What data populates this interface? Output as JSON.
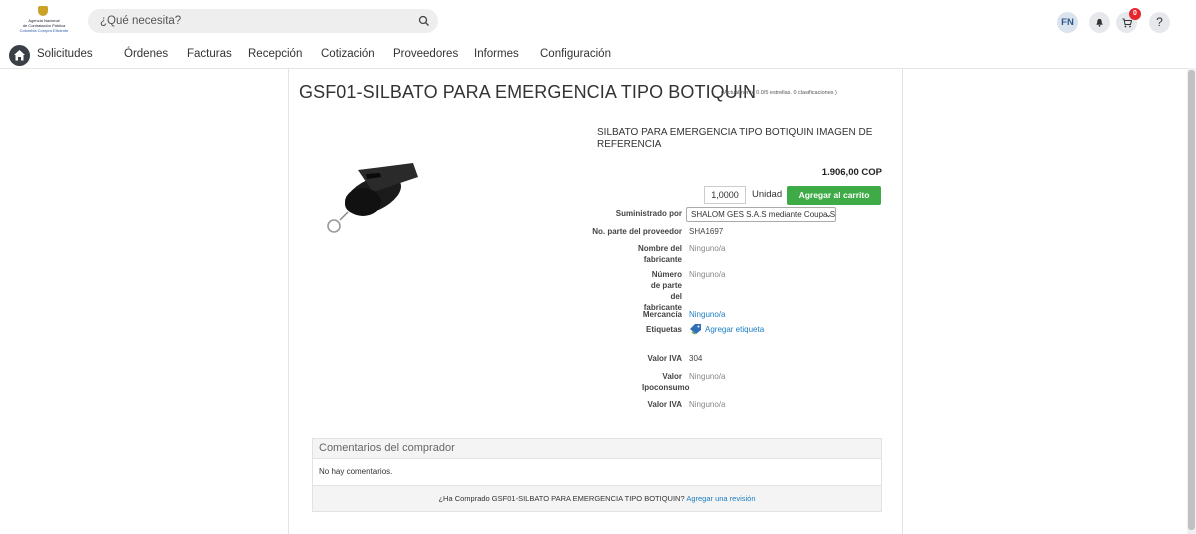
{
  "header": {
    "logo": {
      "line1": "Agencia Nacional",
      "line2": "de Contratación Pública",
      "line3": "Colombia Compra Eficiente"
    },
    "search_placeholder": "¿Qué necesita?",
    "user_initials": "FN",
    "cart_count": "0",
    "help_label": "?"
  },
  "nav": {
    "items": [
      "Solicitudes",
      "Órdenes",
      "Facturas",
      "Recepción",
      "Cotización",
      "Proveedores",
      "Informes",
      "Configuración"
    ]
  },
  "product": {
    "title": "GSF01-SILBATO PARA EMERGENCIA TIPO BOTIQUIN",
    "rating": "( Actualmente 0.0/5 estrellas. 0 clasificaciones )",
    "description": "SILBATO PARA EMERGENCIA TIPO BOTIQUIN IMAGEN DE REFERENCIA",
    "price": "1.906,00 COP",
    "quantity": "1,0000",
    "unit": "Unidad",
    "add_to_cart": "Agregar al carrito",
    "details": {
      "supplied_by_label": "Suministrado por",
      "supplied_by_value": "SHALOM GES S.A.S mediante Coupa Sup...",
      "part_no_label": "No. parte del proveedor",
      "part_no_value": "SHA1697",
      "manufacturer_label": "Nombre del fabricante",
      "manufacturer_value": "Ninguno/a",
      "mfr_part_label": "Número de parte del fabricante",
      "mfr_part_value": "Ninguno/a",
      "commodity_label": "Mercancía",
      "commodity_value": "Ninguno/a",
      "tags_label": "Etiquetas",
      "tags_value": "Agregar etiqueta",
      "iva_label": "Valor IVA",
      "iva_value": "304",
      "ipoconsumo_label": "Valor Ipoconsumo",
      "ipoconsumo_value": "Ninguno/a",
      "iva2_label": "Valor IVA",
      "iva2_value": "Ninguno/a"
    }
  },
  "comments": {
    "title": "Comentarios del comprador",
    "empty": "No hay comentarios.",
    "footer_text": "¿Ha Comprado GSF01-SILBATO PARA EMERGENCIA TIPO BOTIQUIN?",
    "footer_link": "Agregar una revisión"
  },
  "icons": [
    "search-icon",
    "bell-icon",
    "cart-icon",
    "home-icon",
    "tag-icon",
    "chevron-down-icon"
  ],
  "colors": {
    "primary_button": "#3eab47",
    "link": "#1d7ec3",
    "badge": "#e5262d"
  }
}
